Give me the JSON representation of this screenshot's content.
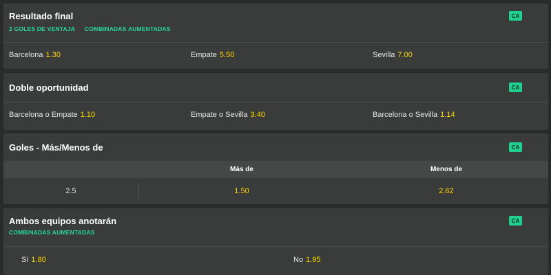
{
  "markets": {
    "result": {
      "title": "Resultado final",
      "tags": [
        "2 GOLES DE VENTAJA",
        "COMBINADAS AUMENTADAS"
      ],
      "badge": "CA",
      "selections": [
        {
          "label": "Barcelona",
          "odds": "1.30"
        },
        {
          "label": "Empate",
          "odds": "5.50"
        },
        {
          "label": "Sevilla",
          "odds": "7.00"
        }
      ]
    },
    "double_chance": {
      "title": "Doble oportunidad",
      "badge": "CA",
      "selections": [
        {
          "label": "Barcelona o Empate",
          "odds": "1.10"
        },
        {
          "label": "Empate o Sevilla",
          "odds": "3.40"
        },
        {
          "label": "Barcelona o Sevilla",
          "odds": "1.14"
        }
      ]
    },
    "goals": {
      "title": "Goles - Más/Menos de",
      "badge": "CA",
      "columns": [
        "Más de",
        "Menos de"
      ],
      "rows": [
        {
          "line": "2.5",
          "over": "1.50",
          "under": "2.62"
        }
      ]
    },
    "btts": {
      "title": "Ambos equipos anotarán",
      "tags": [
        "COMBINADAS AUMENTADAS"
      ],
      "badge": "CA",
      "selections": [
        {
          "label": "Sí",
          "odds": "1.80"
        },
        {
          "label": "No",
          "odds": "1.95"
        }
      ]
    }
  },
  "colors": {
    "background": "#2a2c2b",
    "panel": "#3a3c3b",
    "odds": "#ffd700",
    "tag": "#26d7a4",
    "badge": "#1fd08f"
  }
}
